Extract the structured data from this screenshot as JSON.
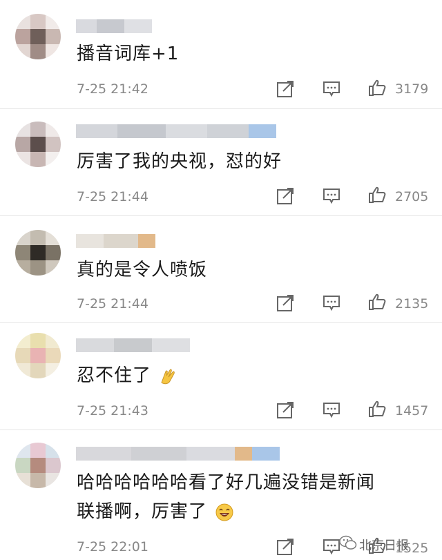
{
  "comments": [
    {
      "text": "播音词库+1",
      "time": "7-25 21:42",
      "likes": "3179"
    },
    {
      "text": "厉害了我的央视，怼的好",
      "time": "7-25 21:44",
      "likes": "2705"
    },
    {
      "text": "真的是令人喷饭",
      "time": "7-25 21:44",
      "likes": "2135"
    },
    {
      "text": "忍不住了",
      "time": "7-25 21:43",
      "likes": "1457",
      "emoji": "clap-hands-emoji"
    },
    {
      "text_line1": "哈哈哈哈哈哈看了好几遍没错是新闻",
      "text_line2": "联播啊，厉害了",
      "time": "7-25 22:01",
      "likes": "1525",
      "emoji": "laughing-face-emoji"
    }
  ],
  "icons": {
    "repost": "edit-share-icon",
    "reply": "comment-icon",
    "like": "thumbs-up-icon"
  },
  "watermark": "北京日报",
  "colors": {
    "accent": "#4a8fd8",
    "text": "#1a1a1a",
    "meta": "#888888",
    "divider": "#e6e6e6"
  }
}
